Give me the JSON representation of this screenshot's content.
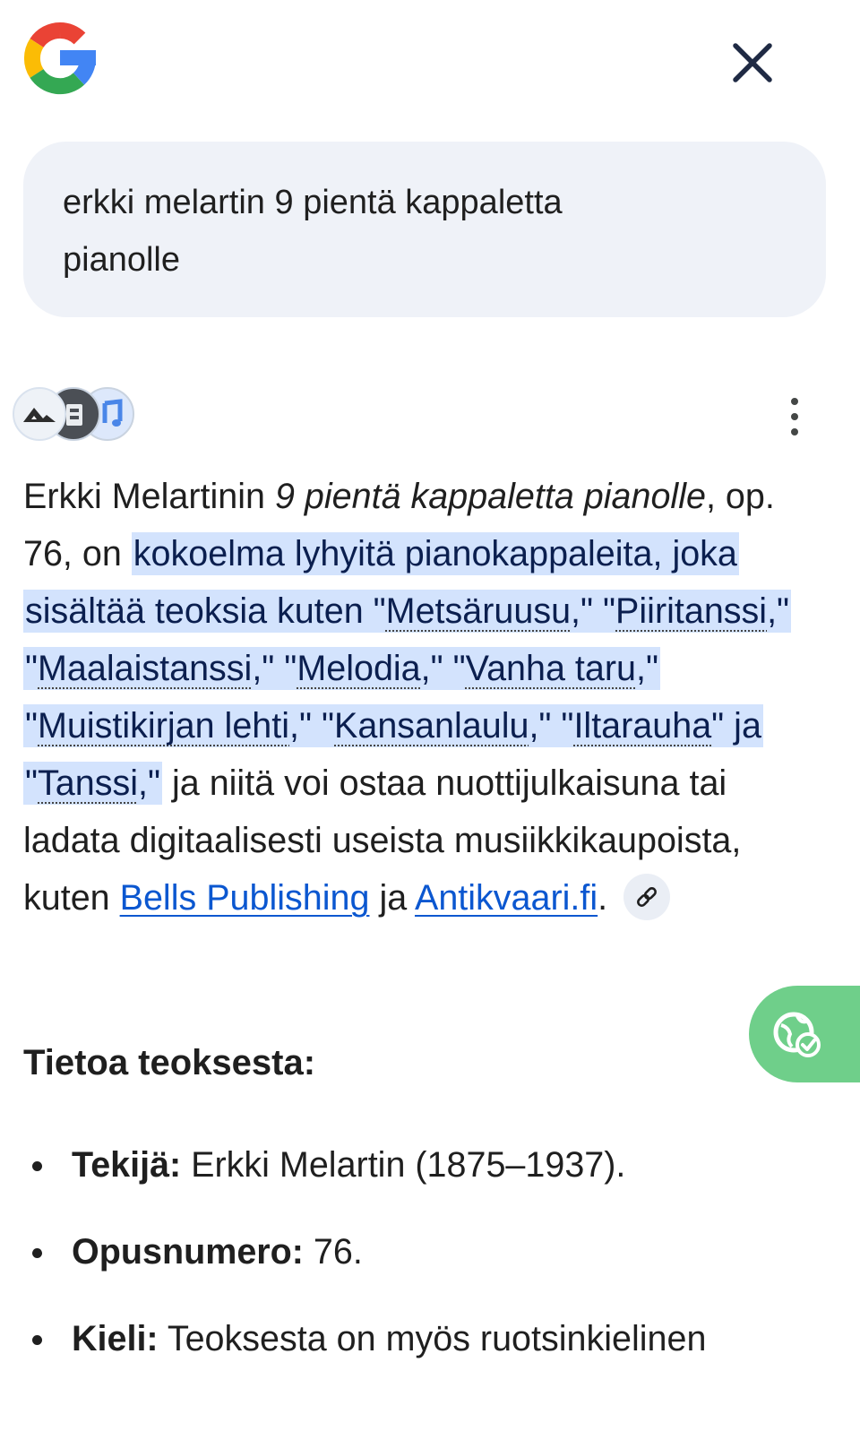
{
  "header": {
    "logo_icon": "google-g-logo",
    "close_icon": "close-icon"
  },
  "query": {
    "text_line1": "erkki melartin 9 pientä kappaletta",
    "text_line2": "pianolle"
  },
  "sources": {
    "icons": [
      "source-favicon-1",
      "source-favicon-2",
      "source-favicon-3"
    ],
    "more_icon": "more-vert-icon"
  },
  "answer": {
    "p1": "Erkki Melartinin ",
    "title_italic": "9 pientä kappaletta pianolle",
    "p2": ", op. 76, on ",
    "hl1": "kokoelma lyhyitä pianokappaleita, joka sisältää teoksia kuten \"",
    "piece1": "Metsäruusu",
    "sep1": ",\" \"",
    "piece2": "Piiritanssi",
    "sep2": ",\" \"",
    "piece3": "Maalaistanssi",
    "sep3": ",\" \"",
    "piece4": "Melodia",
    "sep4": ",\" \"",
    "piece5": "Vanha taru",
    "sep5": ",\" \"",
    "piece6": "Muistikirjan lehti",
    "sep6": ",\" \"",
    "piece7": "Kansanlaulu",
    "sep7": ",\" \"",
    "piece8": "Iltarauha",
    "sep8": "\" ja \"",
    "piece9": "Tanssi",
    "sep9": ",\"",
    "p3": " ja niitä voi ostaa nuottijulkaisuna tai ladata digitaalisesti useista musiikkikaupoista, kuten ",
    "link1": "Bells Publishing",
    "p4": " ja ",
    "link2": "Antikvaari.fi",
    "p5": ".",
    "link_chip_icon": "link-icon"
  },
  "float_button": {
    "icon": "globe-check-icon"
  },
  "section": {
    "title": "Tietoa teoksesta:",
    "bullets": [
      {
        "label": "Tekijä:",
        "text": " Erkki Melartin (1875–1937)."
      },
      {
        "label": "Opusnumero:",
        "text": " 76."
      },
      {
        "label": "Kieli:",
        "text": " Teoksesta on myös ruotsinkielinen"
      }
    ]
  },
  "colors": {
    "highlight": "#d3e3fd",
    "link": "#0b57d0",
    "query_bg": "#eff2f8",
    "float_button": "#6fcf8a"
  }
}
